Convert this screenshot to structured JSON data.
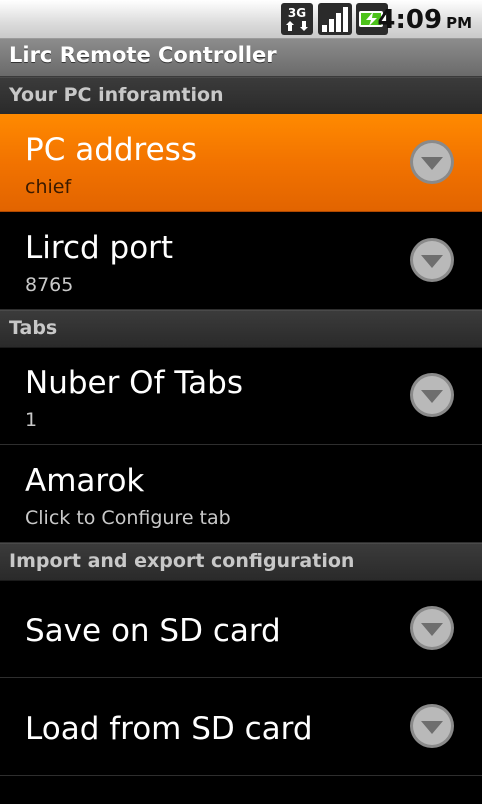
{
  "status_bar": {
    "network_label": "3G",
    "time": "4:09",
    "ampm": "PM",
    "icons": [
      "3g-data-icon",
      "signal-strength-icon",
      "battery-charging-icon"
    ]
  },
  "app": {
    "title": "Lirc Remote Controller"
  },
  "sections": [
    {
      "header": "Your PC inforamtion",
      "items": [
        {
          "title": "PC address",
          "summary": "chief",
          "selected": true,
          "has_dropdown": true
        },
        {
          "title": "Lircd port",
          "summary": "8765",
          "selected": false,
          "has_dropdown": true
        }
      ]
    },
    {
      "header": "Tabs",
      "items": [
        {
          "title": "Nuber Of Tabs",
          "summary": "1",
          "selected": false,
          "has_dropdown": true
        },
        {
          "title": "Amarok",
          "summary": "Click to Configure tab",
          "selected": false,
          "has_dropdown": false
        }
      ]
    },
    {
      "header": "Import and export configuration",
      "items": [
        {
          "title": "Save on SD card",
          "summary": "",
          "selected": false,
          "has_dropdown": true
        },
        {
          "title": "Load from SD card",
          "summary": "",
          "selected": false,
          "has_dropdown": true
        }
      ]
    }
  ],
  "colors": {
    "selected_highlight": "#f27300",
    "background": "#000000",
    "battery_accent": "#4cc21a"
  }
}
